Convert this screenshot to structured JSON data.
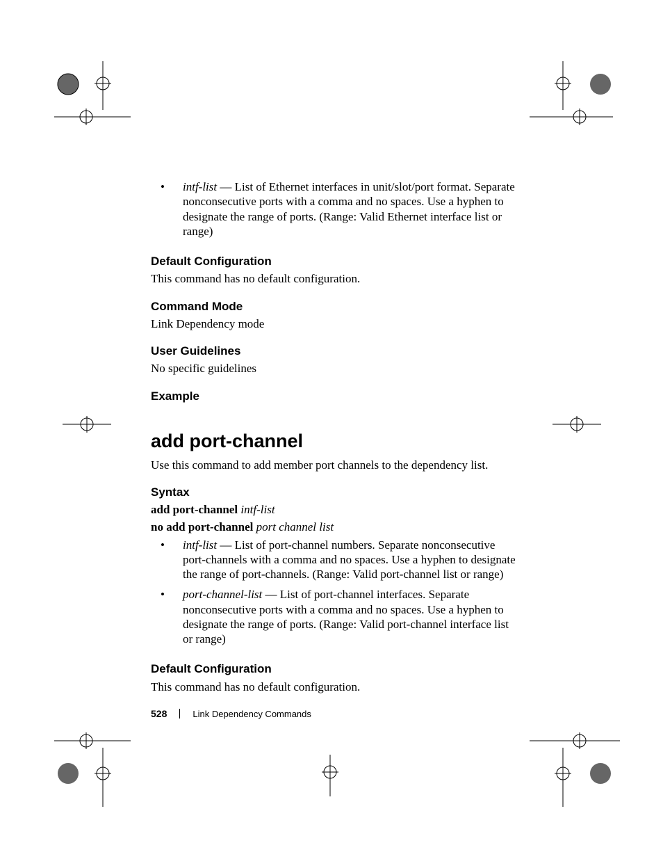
{
  "top_bullet": {
    "term": "intf-list",
    "text": " — List of Ethernet interfaces in unit/slot/port format. Separate nonconsecutive ports with a comma and no spaces. Use a hyphen to designate the range of ports. (Range: Valid Ethernet interface list or range)"
  },
  "sections": {
    "default_config1": {
      "heading": "Default Configuration",
      "body": "This command has no default configuration."
    },
    "command_mode": {
      "heading": "Command Mode",
      "body": "Link Dependency mode"
    },
    "user_guidelines": {
      "heading": "User Guidelines",
      "body": "No specific guidelines"
    },
    "example": {
      "heading": "Example"
    }
  },
  "command": {
    "title": "add port-channel",
    "intro": "Use this command to add member port channels to the dependency list."
  },
  "syntax": {
    "heading": "Syntax",
    "line1_bold": "add port-channel ",
    "line1_italic": "intf-list",
    "line2_bold": "no add port-channel ",
    "line2_italic": "port channel list",
    "bullets": [
      {
        "term": "intf-list",
        "text": " — List of port-channel numbers. Separate nonconsecutive port-channels with a comma and no spaces. Use a hyphen to designate the range of port-channels. (Range: Valid port-channel list or range)"
      },
      {
        "term": "port-channel-list",
        "text": " — List of port-channel interfaces. Separate nonconsecutive ports with a comma and no spaces. Use a hyphen to designate the range of ports. (Range: Valid port-channel interface list or range)"
      }
    ]
  },
  "default_config2": {
    "heading": "Default Configuration",
    "body": "This command has no default configuration."
  },
  "footer": {
    "page": "528",
    "section": "Link Dependency Commands"
  }
}
